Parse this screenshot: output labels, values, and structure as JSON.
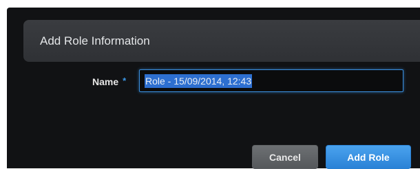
{
  "dialog": {
    "title": "Add Role Information",
    "form": {
      "name_label": "Name",
      "required_marker": "*",
      "name_value": "Role - 15/09/2014, 12:43"
    },
    "buttons": {
      "cancel_label": "Cancel",
      "submit_label": "Add Role"
    }
  },
  "colors": {
    "dialog_background": "#111214",
    "header_background": "#35373b",
    "accent_blue": "#3b97e6",
    "selection_highlight": "#2d6fd0",
    "cancel_button": "#606366",
    "submit_button": "#3a93e2"
  }
}
